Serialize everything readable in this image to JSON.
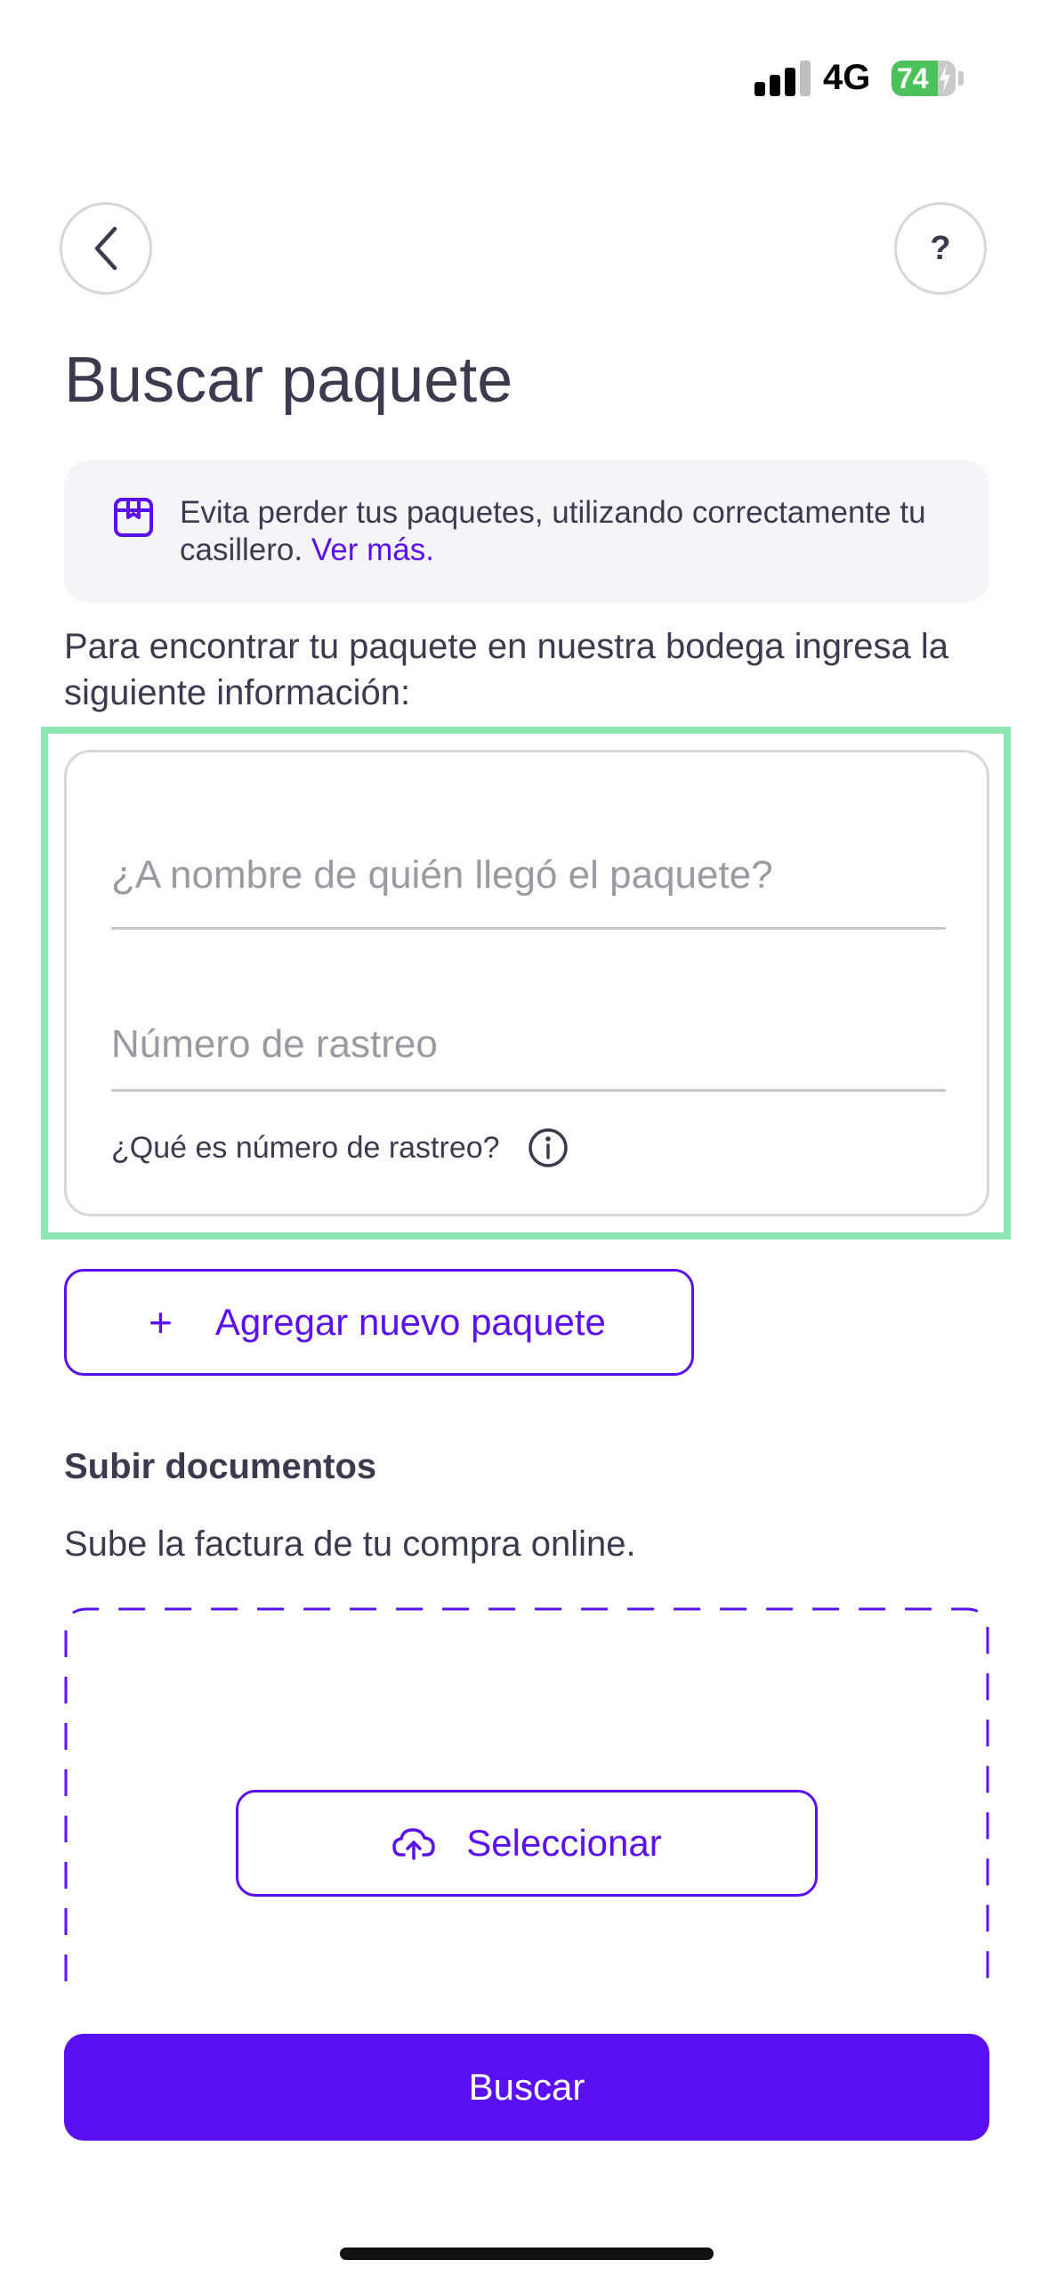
{
  "status_bar": {
    "network": "4G",
    "battery": "74"
  },
  "header": {
    "title": "Buscar paquete",
    "help_label": "?"
  },
  "info_card": {
    "text": "Evita perder tus paquetes, utilizando correctamente tu casillero.",
    "link": "Ver más."
  },
  "instructions": "Para encontrar tu paquete en nuestra bodega ingresa la siguiente información:",
  "form": {
    "name_placeholder": "¿A nombre de quién llegó el paquete?",
    "tracking_placeholder": "Número de rastreo",
    "tracking_help": "¿Qué es número de rastreo?"
  },
  "add_package": {
    "icon": "+",
    "label": "Agregar nuevo paquete"
  },
  "upload": {
    "title": "Subir documentos",
    "subtitle": "Sube la factura de tu compra online.",
    "select_label": "Seleccionar"
  },
  "primary_action": {
    "label": "Buscar"
  },
  "colors": {
    "accent": "#5a10f0",
    "text": "#3b3b4f",
    "highlight": "#8ee6b1",
    "battery": "#4cc35a"
  },
  "icons": {
    "back": "chevron-left-icon",
    "package": "package-icon",
    "info": "info-icon",
    "upload": "cloud-upload-icon"
  }
}
